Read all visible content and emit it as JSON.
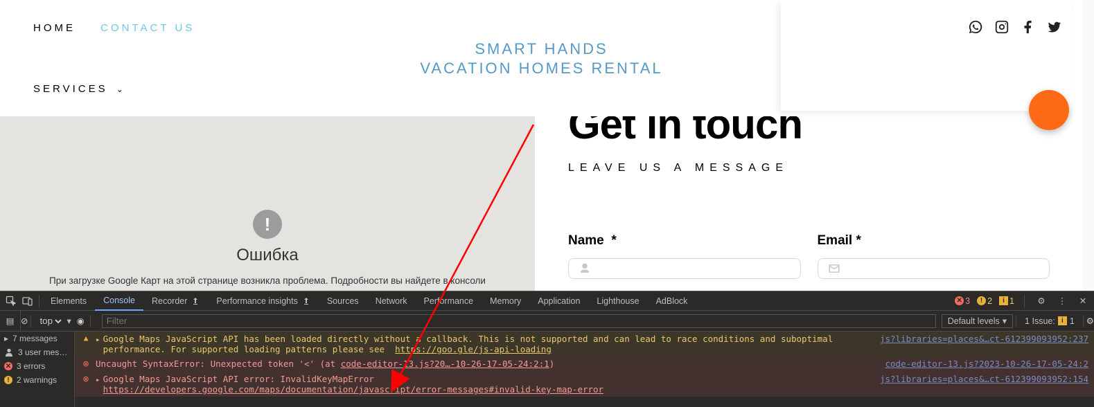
{
  "nav": {
    "home": "HOME",
    "contact": "CONTACT US",
    "services": "SERVICES"
  },
  "logo": {
    "line1": "SMART     HANDS",
    "line2": "VACATION HOMES RENTAL"
  },
  "map_error": {
    "icon": "!",
    "title": "Ошибка",
    "text": "При загрузке Google Карт на этой странице возникла проблема. Подробности вы найдете в консоли"
  },
  "page": {
    "heading": "Get in touch",
    "subheading": "LEAVE US A MESSAGE",
    "name_label": "Name",
    "email_label": "Email",
    "req": "*"
  },
  "devtools": {
    "tabs": {
      "elements": "Elements",
      "console": "Console",
      "recorder": "Recorder",
      "perf_insights": "Performance insights",
      "sources": "Sources",
      "network": "Network",
      "performance": "Performance",
      "memory": "Memory",
      "application": "Application",
      "lighthouse": "Lighthouse",
      "adblock": "AdBlock"
    },
    "counts": {
      "errors": "3",
      "warnings": "2",
      "info": "1"
    },
    "toolbar": {
      "context": "top",
      "filter_placeholder": "Filter",
      "levels": "Default levels",
      "issue": "1 Issue:",
      "issue_count": "1"
    },
    "rail": {
      "messages": "7 messages",
      "user": "3 user mes…",
      "errors": "3 errors",
      "warnings": "2 warnings"
    },
    "msg1": {
      "text": "Google Maps JavaScript API has been loaded directly without a callback. This is not supported and can lead to race conditions and suboptimal performance. For supported loading patterns please see ",
      "link": "https://goo.gle/js-api-loading",
      "origin": "js?libraries=places&…ct-612399093952:237"
    },
    "msg2": {
      "pre": "Uncaught SyntaxError: Unexpected token '<' (at ",
      "link": "code-editor-13.js?20…-10-26-17-05-24:2:1",
      "post": ")",
      "origin": "code-editor-13.js?2023-10-26-17-05-24:2"
    },
    "msg3": {
      "label": "Google Maps JavaScript API error: InvalidKeyMapError",
      "link": "https://developers.google.com/maps/documentation/javascript/error-messages#invalid-key-map-error",
      "origin": "js?libraries=places&…ct-612399093952:154"
    }
  }
}
